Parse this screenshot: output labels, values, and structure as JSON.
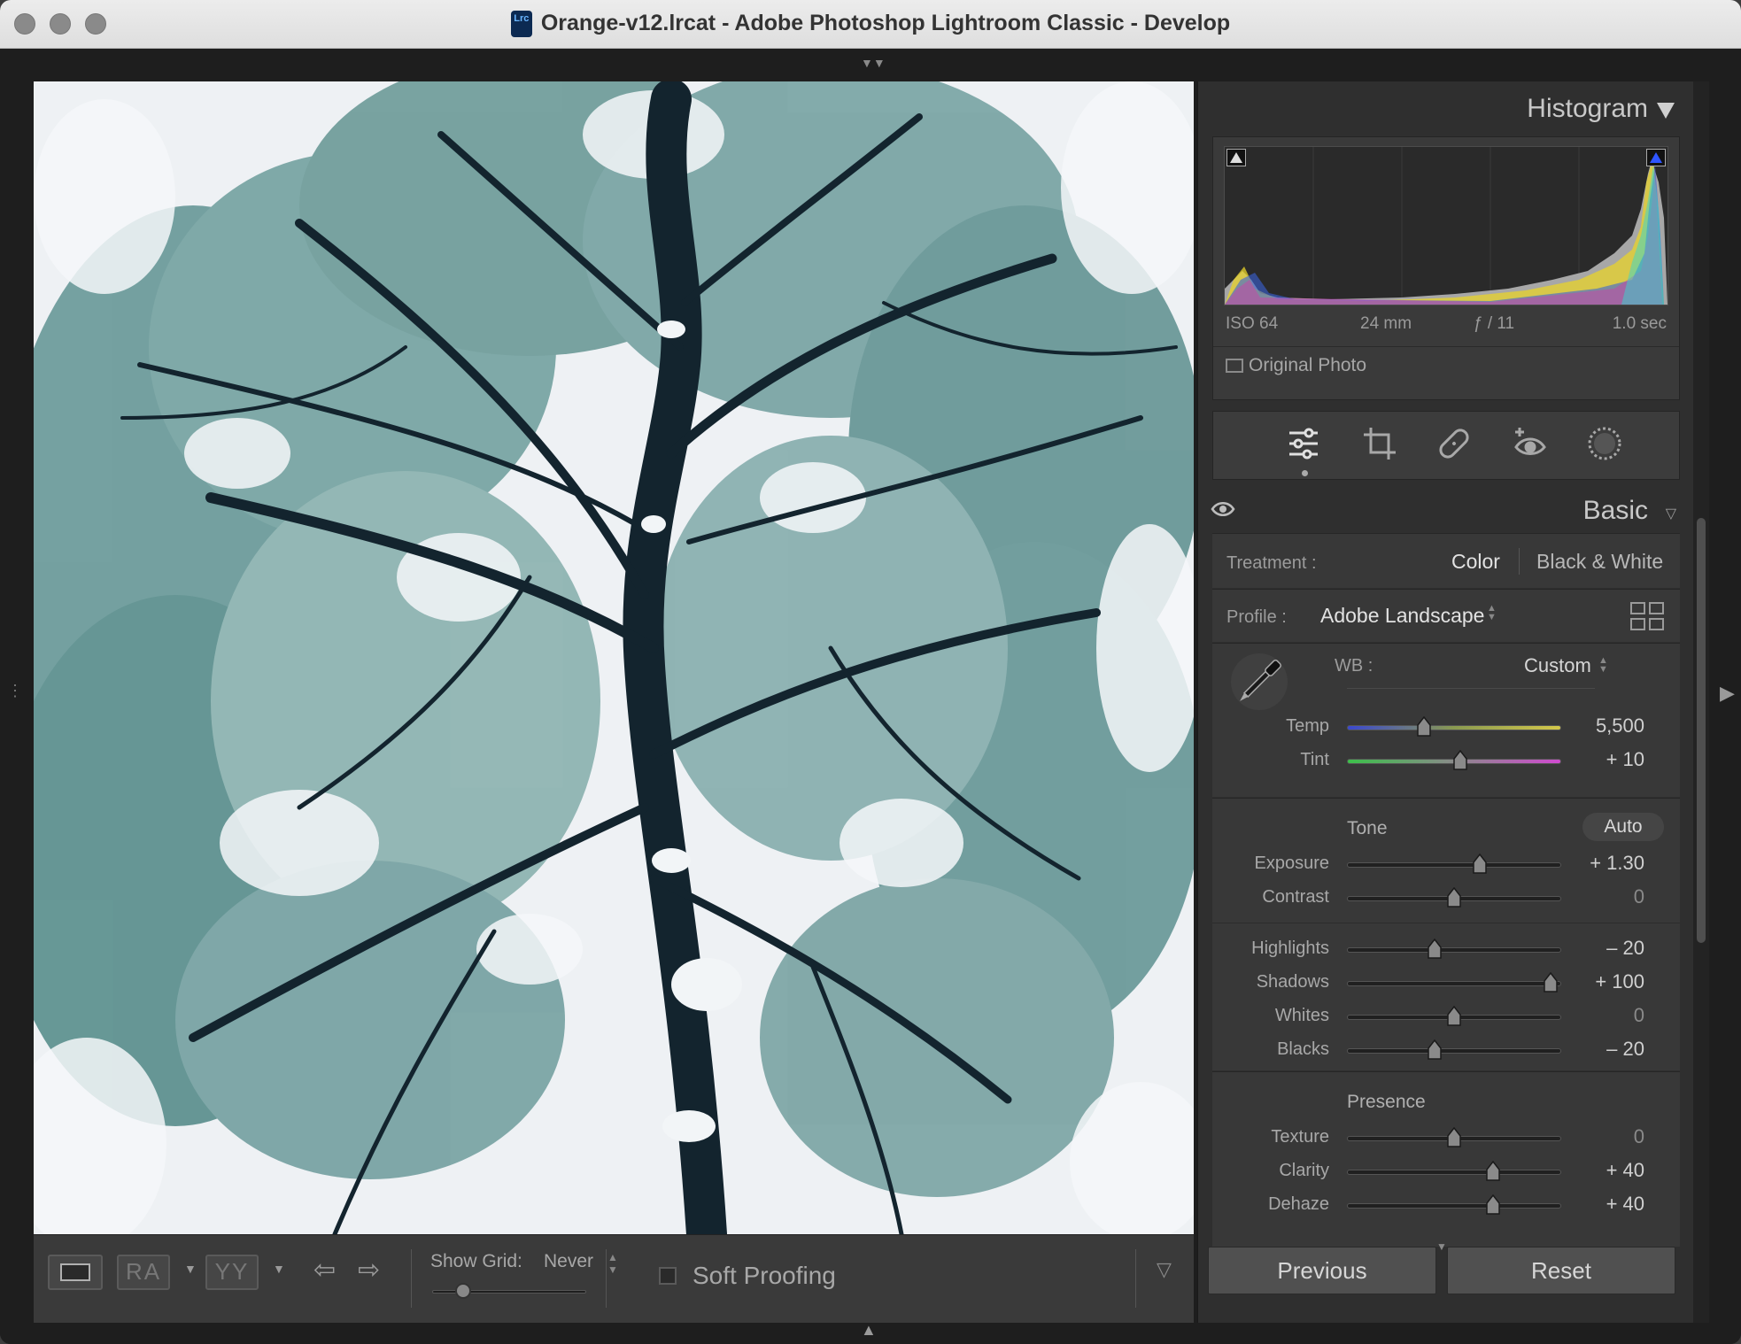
{
  "window": {
    "title": "Orange-v12.lrcat - Adobe Photoshop Lightroom Classic - Develop",
    "app_icon": "Lrc"
  },
  "toolbar": {
    "grid_label": "Show Grid:",
    "grid_value": "Never",
    "soft_proofing_label": "Soft Proofing",
    "ra_label": "RA",
    "yy_label": "YY"
  },
  "histogram": {
    "title": "Histogram",
    "iso": "ISO 64",
    "focal": "24 mm",
    "aperture": "ƒ / 11",
    "shutter": "1.0 sec",
    "original_photo_label": "Original Photo"
  },
  "basic": {
    "title": "Basic",
    "treatment_label": "Treatment :",
    "treatment_color": "Color",
    "treatment_bw": "Black & White",
    "profile_label": "Profile :",
    "profile_value": "Adobe Landscape",
    "wb_label": "WB :",
    "wb_value": "Custom",
    "tone_label": "Tone",
    "auto_label": "Auto",
    "presence_label": "Presence",
    "sliders": {
      "temp": {
        "label": "Temp",
        "value": "5,500",
        "pos": 0.36
      },
      "tint": {
        "label": "Tint",
        "value": "+ 10",
        "pos": 0.53
      },
      "exposure": {
        "label": "Exposure",
        "value": "+ 1.30",
        "pos": 0.62
      },
      "contrast": {
        "label": "Contrast",
        "value": "0",
        "pos": 0.5
      },
      "highlights": {
        "label": "Highlights",
        "value": "– 20",
        "pos": 0.41
      },
      "shadows": {
        "label": "Shadows",
        "value": "+ 100",
        "pos": 0.95
      },
      "whites": {
        "label": "Whites",
        "value": "0",
        "pos": 0.5
      },
      "blacks": {
        "label": "Blacks",
        "value": "– 20",
        "pos": 0.41
      },
      "texture": {
        "label": "Texture",
        "value": "0",
        "pos": 0.5
      },
      "clarity": {
        "label": "Clarity",
        "value": "+ 40",
        "pos": 0.68
      },
      "dehaze": {
        "label": "Dehaze",
        "value": "+ 40",
        "pos": 0.68
      }
    }
  },
  "buttons": {
    "previous": "Previous",
    "reset": "Reset"
  },
  "colors": {
    "panel_bg": "#2f2f2f",
    "section_bg": "#383838",
    "text_light": "#d0d0d0",
    "text_dim": "#9c9c9c"
  }
}
